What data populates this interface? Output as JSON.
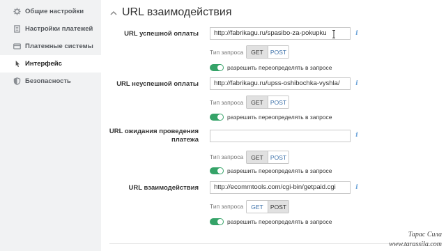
{
  "sidebar": {
    "items": [
      {
        "label": "Общие настройки",
        "icon": "gear-icon"
      },
      {
        "label": "Настройки платежей",
        "icon": "document-icon"
      },
      {
        "label": "Платежные системы",
        "icon": "card-icon"
      },
      {
        "label": "Интерфейс",
        "icon": "pointer-icon",
        "active": true
      },
      {
        "label": "Безопасность",
        "icon": "shield-icon"
      }
    ]
  },
  "section": {
    "title": "URL взаимодействия",
    "icon": "chevron-up-icon"
  },
  "fields": [
    {
      "label": "URL успешной оплаты",
      "value": "http://fabrikagu.ru/spasibo-za-pokupku",
      "request_type_label": "Тип запроса",
      "get_label": "GET",
      "post_label": "POST",
      "selected": "GET",
      "toggle_label": "разрешить переопределять в запросе",
      "toggle_on": true
    },
    {
      "label": "URL неуспешной оплаты",
      "value": "http://fabrikagu.ru/upss-oshibochka-vyshla/",
      "request_type_label": "Тип запроса",
      "get_label": "GET",
      "post_label": "POST",
      "selected": "GET",
      "toggle_label": "разрешить переопределять в запросе",
      "toggle_on": true
    },
    {
      "label": "URL ожидания проведения платежа",
      "value": "",
      "request_type_label": "Тип запроса",
      "get_label": "GET",
      "post_label": "POST",
      "selected": "GET",
      "toggle_label": "разрешить переопределять в запросе",
      "toggle_on": true
    },
    {
      "label": "URL взаимодействия",
      "value": "http://ecommtools.com/cgi-bin/getpaid.cgi",
      "request_type_label": "Тип запроса",
      "get_label": "GET",
      "post_label": "POST",
      "selected": "POST",
      "toggle_label": "разрешить переопределять в запросе",
      "toggle_on": true
    }
  ],
  "watermark": {
    "author": "Тарас Сила",
    "site": "www.tarassila.com"
  },
  "colors": {
    "toggle_on": "#35a368",
    "link_blue": "#3a6fa8",
    "sidebar_bg": "#f1f2f3"
  }
}
